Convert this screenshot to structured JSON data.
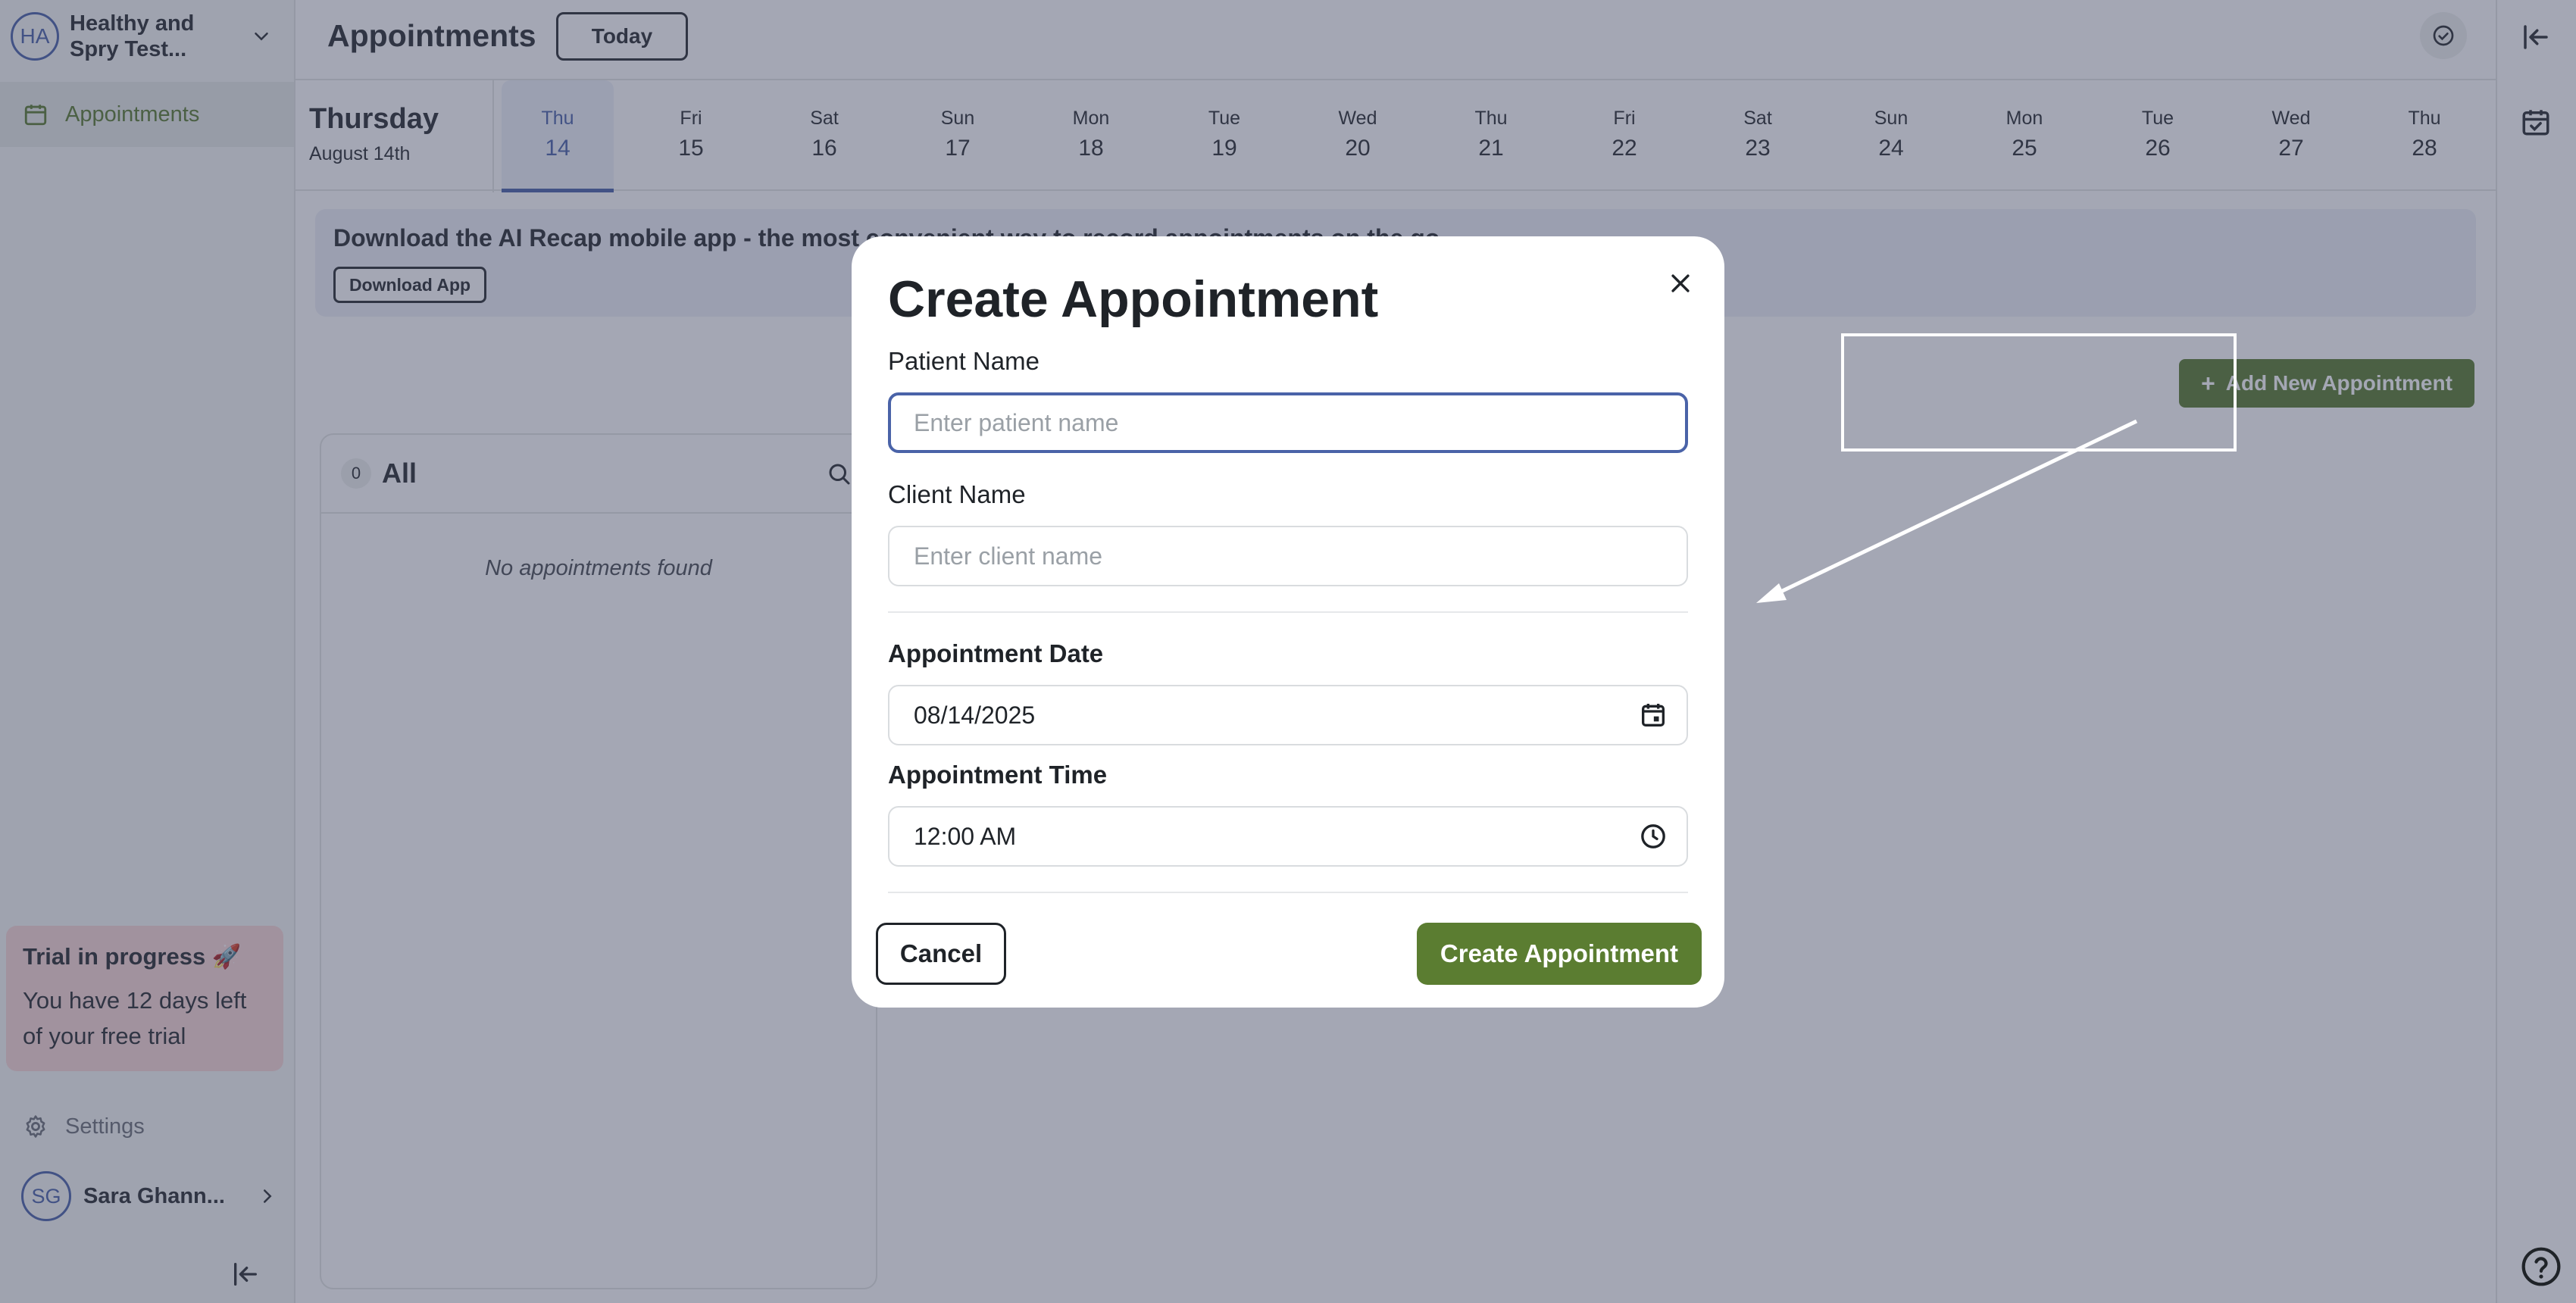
{
  "sidebar": {
    "org_initials": "HA",
    "org_name": "Healthy and Spry Test...",
    "nav_label": "Appointments",
    "trial_title": "Trial in progress 🚀",
    "trial_text": "You have 12 days left of your free trial",
    "settings_label": "Settings",
    "user_initials": "SG",
    "user_name": "Sara Ghann..."
  },
  "header": {
    "title": "Appointments",
    "today_label": "Today"
  },
  "datebar": {
    "current_day": "Thursday",
    "current_date": "August 14th",
    "days": [
      {
        "dow": "Thu",
        "num": "14",
        "selected": true
      },
      {
        "dow": "Fri",
        "num": "15"
      },
      {
        "dow": "Sat",
        "num": "16"
      },
      {
        "dow": "Sun",
        "num": "17"
      },
      {
        "dow": "Mon",
        "num": "18"
      },
      {
        "dow": "Tue",
        "num": "19"
      },
      {
        "dow": "Wed",
        "num": "20"
      },
      {
        "dow": "Thu",
        "num": "21"
      },
      {
        "dow": "Fri",
        "num": "22"
      },
      {
        "dow": "Sat",
        "num": "23"
      },
      {
        "dow": "Sun",
        "num": "24"
      },
      {
        "dow": "Mon",
        "num": "25"
      },
      {
        "dow": "Tue",
        "num": "26"
      },
      {
        "dow": "Wed",
        "num": "27"
      },
      {
        "dow": "Thu",
        "num": "28"
      }
    ]
  },
  "banner": {
    "text": "Download the AI Recap mobile app - the most convenient way to record appointments on the go",
    "button_label": "Download App"
  },
  "actions": {
    "add_label": "Add New Appointment"
  },
  "list": {
    "count": "0",
    "title": "All",
    "empty_text": "No appointments found"
  },
  "modal": {
    "title": "Create Appointment",
    "patient_label": "Patient Name",
    "patient_placeholder": "Enter patient name",
    "patient_value": "",
    "client_label": "Client Name",
    "client_placeholder": "Enter client name",
    "client_value": "",
    "date_label": "Appointment Date",
    "date_value": "08/14/2025",
    "time_label": "Appointment Time",
    "time_value": "12:00 AM",
    "cancel_label": "Cancel",
    "create_label": "Create Appointment"
  },
  "colors": {
    "accent_green": "#5b7d31",
    "accent_blue": "#4a63a8",
    "trial_bg": "#f9d9d7",
    "overlay": "rgba(56,63,92,0.46)"
  }
}
